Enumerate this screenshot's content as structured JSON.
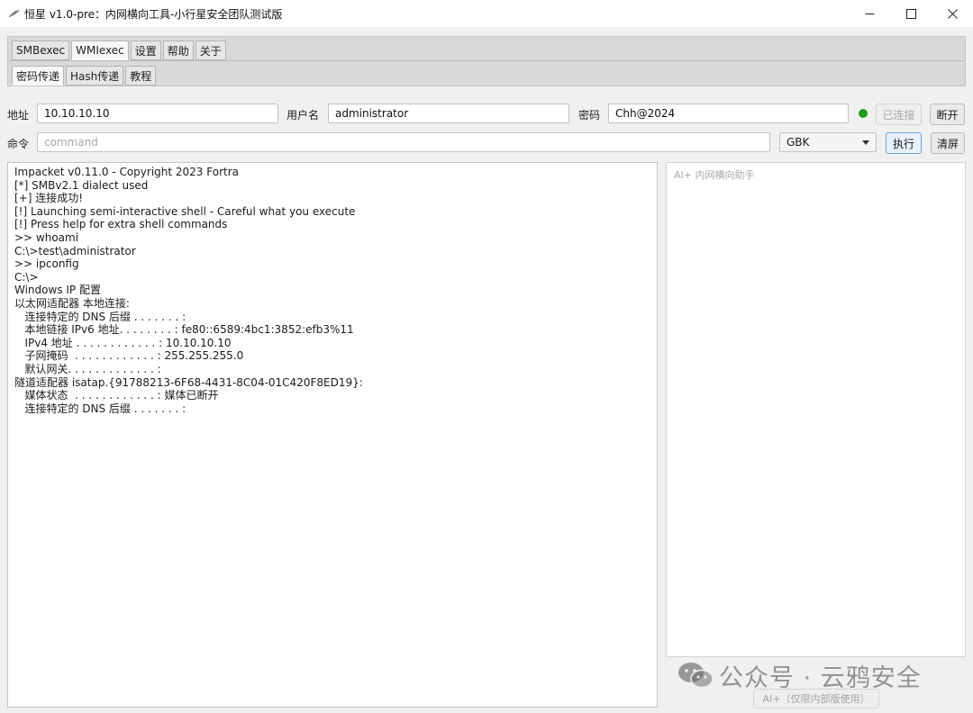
{
  "window": {
    "title": "恒星 v1.0-pre：内网横向工具-小行星安全团队测试版",
    "app_icon": "feather-icon",
    "controls": [
      "minimize-icon",
      "maximize-icon",
      "close-icon"
    ]
  },
  "tabs": {
    "main": [
      "SMBexec",
      "WMIexec",
      "设置",
      "帮助",
      "关于"
    ],
    "main_active": "WMIexec",
    "sub": [
      "密码传递",
      "Hash传递",
      "教程"
    ],
    "sub_active": "密码传递"
  },
  "form": {
    "address_label": "地址",
    "address_value": "10.10.10.10",
    "username_label": "用户名",
    "username_value": "administrator",
    "password_label": "密码",
    "password_value": "Chh@2024",
    "status_color": "#1f9d1f",
    "connected_button": "已连接",
    "disconnect_button": "断开",
    "command_label": "命令",
    "command_placeholder": "command",
    "encoding_value": "GBK",
    "execute_button": "执行",
    "clear_button": "清屏"
  },
  "console": {
    "lines": [
      "Impacket v0.11.0 - Copyright 2023 Fortra",
      "[*] SMBv2.1 dialect used",
      "[+] 连接成功!",
      "[!] Launching semi-interactive shell - Careful what you execute",
      "[!] Press help for extra shell commands",
      ">> whoami",
      "C:\\>test\\administrator",
      ">> ipconfig",
      "C:\\>",
      "Windows IP 配置",
      "以太网适配器 本地连接:",
      "   连接特定的 DNS 后缀 . . . . . . . :",
      "   本地链接 IPv6 地址. . . . . . . . : fe80::6589:4bc1:3852:efb3%11",
      "   IPv4 地址 . . . . . . . . . . . . : 10.10.10.10",
      "   子网掩码  . . . . . . . . . . . . : 255.255.255.0",
      "   默认网关. . . . . . . . . . . . . :",
      "隧道适配器 isatap.{91788213-6F68-4431-8C04-01C420F8ED19}:",
      "   媒体状态  . . . . . . . . . . . . : 媒体已断开",
      "   连接特定的 DNS 后缀 . . . . . . . :"
    ]
  },
  "ai": {
    "placeholder": "AI+ 内网横向助手",
    "button": "AI+（仅限内部版使用）"
  },
  "watermark": {
    "text": "公众号 · 云鸦安全",
    "icon": "wechat-icon"
  }
}
